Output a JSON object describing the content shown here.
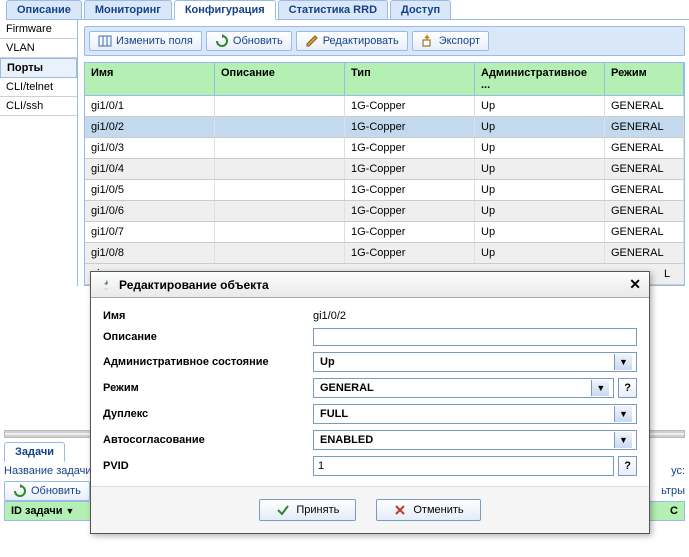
{
  "tabs": [
    "Описание",
    "Мониторинг",
    "Конфигурация",
    "Статистика RRD",
    "Доступ"
  ],
  "active_tab_index": 2,
  "sidebar": {
    "items": [
      "Firmware",
      "VLAN",
      "Порты",
      "CLI/telnet",
      "CLI/ssh"
    ],
    "active_index": 2
  },
  "toolbar": {
    "edit_fields": "Изменить поля",
    "refresh": "Обновить",
    "edit": "Редактировать",
    "export": "Экспорт"
  },
  "grid": {
    "headers": [
      "Имя",
      "Описание",
      "Тип",
      "Административное ...",
      "Режим"
    ],
    "rows": [
      {
        "name": "gi1/0/1",
        "desc": "",
        "type": "1G-Copper",
        "admin": "Up",
        "mode": "GENERAL"
      },
      {
        "name": "gi1/0/2",
        "desc": "",
        "type": "1G-Copper",
        "admin": "Up",
        "mode": "GENERAL"
      },
      {
        "name": "gi1/0/3",
        "desc": "",
        "type": "1G-Copper",
        "admin": "Up",
        "mode": "GENERAL"
      },
      {
        "name": "gi1/0/4",
        "desc": "",
        "type": "1G-Copper",
        "admin": "Up",
        "mode": "GENERAL"
      },
      {
        "name": "gi1/0/5",
        "desc": "",
        "type": "1G-Copper",
        "admin": "Up",
        "mode": "GENERAL"
      },
      {
        "name": "gi1/0/6",
        "desc": "",
        "type": "1G-Copper",
        "admin": "Up",
        "mode": "GENERAL"
      },
      {
        "name": "gi1/0/7",
        "desc": "",
        "type": "1G-Copper",
        "admin": "Up",
        "mode": "GENERAL"
      },
      {
        "name": "gi1/0/8",
        "desc": "",
        "type": "1G-Copper",
        "admin": "Up",
        "mode": "GENERAL"
      }
    ],
    "selected_index": 1,
    "partial_row_left": "gi",
    "partial_row_right": "L"
  },
  "dialog": {
    "title": "Редактирование объекта",
    "fields": {
      "name_label": "Имя",
      "name_value": "gi1/0/2",
      "desc_label": "Описание",
      "desc_value": "",
      "admin_label": "Административное состояние",
      "admin_value": "Up",
      "mode_label": "Режим",
      "mode_value": "GENERAL",
      "duplex_label": "Дуплекс",
      "duplex_value": "FULL",
      "autoneg_label": "Автосогласование",
      "autoneg_value": "ENABLED",
      "pvid_label": "PVID",
      "pvid_value": "1"
    },
    "accept": "Принять",
    "cancel": "Отменить",
    "help": "?"
  },
  "lower": {
    "tasks_tab": "Задачи",
    "task_name_label": "Название задачи",
    "status_suffix": "ус:",
    "refresh": "Обновить",
    "filters_suffix": "ьтры",
    "id_header": "ID задачи",
    "c_header": "С"
  }
}
